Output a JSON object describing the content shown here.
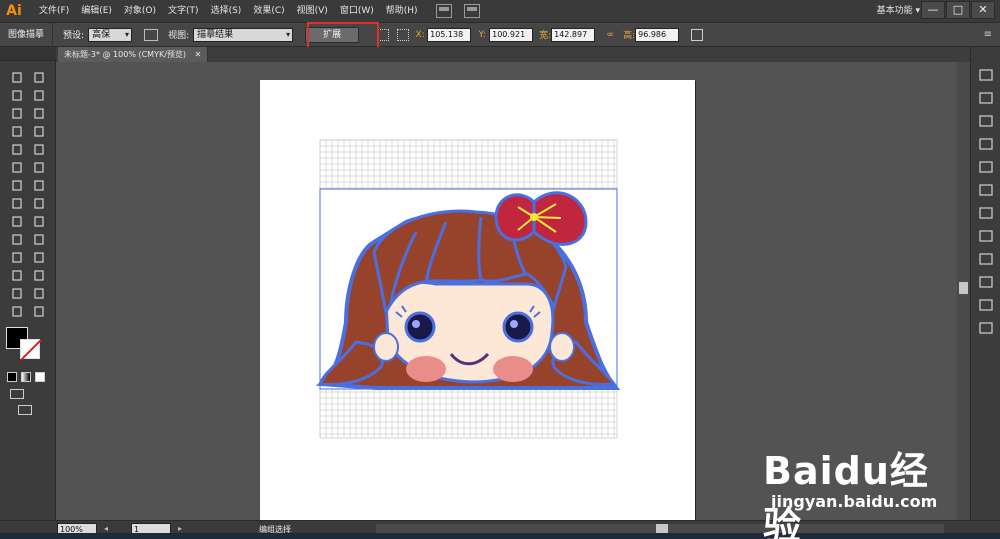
{
  "menubar": {
    "logo": "Ai",
    "items": [
      "文件(F)",
      "编辑(E)",
      "对象(O)",
      "文字(T)",
      "选择(S)",
      "效果(C)",
      "视图(V)",
      "窗口(W)",
      "帮助(H)"
    ],
    "workspace": "基本功能",
    "window_controls": [
      "—",
      "□",
      "✕"
    ]
  },
  "controlbar": {
    "title": "图像描摹",
    "preset_label": "预设:",
    "preset_value": "高保",
    "view_label": "视图:",
    "view_value": "描摹结果",
    "expand_label": "扩展",
    "x_label": "X:",
    "x_value": "105.138",
    "y_label": "Y:",
    "y_value": "100.921",
    "w_label": "宽:",
    "w_value": "142.897",
    "h_label": "高:",
    "h_value": "96.986"
  },
  "document": {
    "tab_label": "未标题-3* @ 100% (CMYK/预览)"
  },
  "statusbar": {
    "zoom": "100%",
    "page": "1",
    "status": "编组选择"
  },
  "watermark": {
    "logo": "Baidu经验",
    "url": "jingyan.baidu.com"
  },
  "colors": {
    "hair": "#97432c",
    "outline": "#4a6fe0",
    "bow": "#c0263e",
    "skin": "#fde7d6",
    "cheek": "#ea8d8a",
    "highlight": "#e0302a"
  }
}
